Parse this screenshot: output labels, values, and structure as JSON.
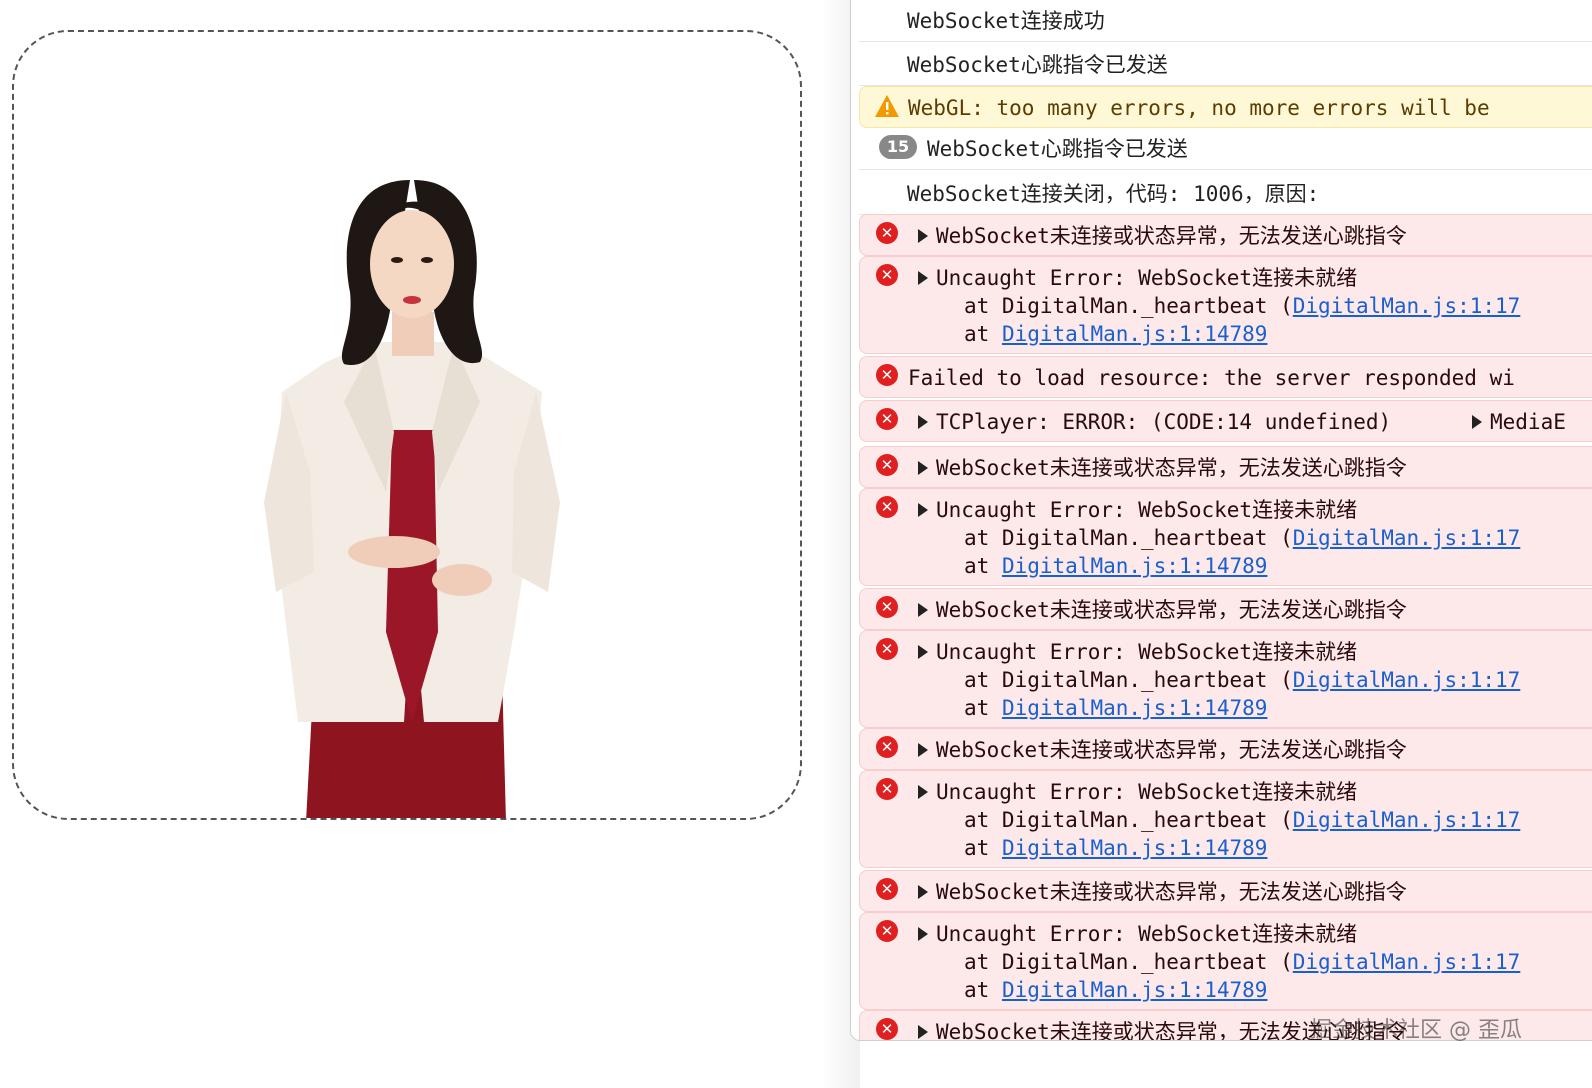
{
  "console": {
    "rows": [
      {
        "type": "info",
        "lines": [
          {
            "text": "WebSocket连接成功"
          }
        ]
      },
      {
        "type": "info",
        "lines": [
          {
            "text": "WebSocket心跳指令已发送"
          }
        ]
      },
      {
        "type": "warn",
        "lines": [
          {
            "text": "WebGL: too many errors, no more errors will be"
          }
        ]
      },
      {
        "type": "info",
        "count": "15",
        "lines": [
          {
            "text": "WebSocket心跳指令已发送"
          }
        ]
      },
      {
        "type": "info",
        "lines": [
          {
            "text": "WebSocket连接关闭，代码: 1006，原因:"
          }
        ]
      },
      {
        "type": "error",
        "expand": true,
        "lines": [
          {
            "text": "WebSocket未连接或状态异常，无法发送心跳指令"
          }
        ]
      },
      {
        "type": "error",
        "expand": true,
        "lines": [
          {
            "text": "Uncaught Error: WebSocket连接未就绪"
          },
          {
            "text": "at DigitalMan._heartbeat (",
            "link": "DigitalMan.js:1:17"
          },
          {
            "text": "at ",
            "link": "DigitalMan.js:1:14789"
          }
        ]
      },
      {
        "type": "error",
        "expand": false,
        "lines": [
          {
            "text": "Failed to load resource: the server responded wi"
          }
        ]
      },
      {
        "type": "error",
        "expand": true,
        "lines": [
          {
            "text": "TCPlayer: ERROR: (CODE:14 undefined)",
            "extra": "MediaE"
          }
        ]
      },
      {
        "type": "error",
        "expand": true,
        "lines": [
          {
            "text": "WebSocket未连接或状态异常，无法发送心跳指令"
          }
        ]
      },
      {
        "type": "error",
        "expand": true,
        "lines": [
          {
            "text": "Uncaught Error: WebSocket连接未就绪"
          },
          {
            "text": "at DigitalMan._heartbeat (",
            "link": "DigitalMan.js:1:17"
          },
          {
            "text": "at ",
            "link": "DigitalMan.js:1:14789"
          }
        ]
      },
      {
        "type": "error",
        "expand": true,
        "lines": [
          {
            "text": "WebSocket未连接或状态异常，无法发送心跳指令"
          }
        ]
      },
      {
        "type": "error",
        "expand": true,
        "lines": [
          {
            "text": "Uncaught Error: WebSocket连接未就绪"
          },
          {
            "text": "at DigitalMan._heartbeat (",
            "link": "DigitalMan.js:1:17"
          },
          {
            "text": "at ",
            "link": "DigitalMan.js:1:14789"
          }
        ]
      },
      {
        "type": "error",
        "expand": true,
        "lines": [
          {
            "text": "WebSocket未连接或状态异常，无法发送心跳指令"
          }
        ]
      },
      {
        "type": "error",
        "expand": true,
        "lines": [
          {
            "text": "Uncaught Error: WebSocket连接未就绪"
          },
          {
            "text": "at DigitalMan._heartbeat (",
            "link": "DigitalMan.js:1:17"
          },
          {
            "text": "at ",
            "link": "DigitalMan.js:1:14789"
          }
        ]
      },
      {
        "type": "error",
        "expand": true,
        "lines": [
          {
            "text": "WebSocket未连接或状态异常，无法发送心跳指令"
          }
        ]
      },
      {
        "type": "error",
        "expand": true,
        "lines": [
          {
            "text": "Uncaught Error: WebSocket连接未就绪"
          },
          {
            "text": "at DigitalMan._heartbeat (",
            "link": "DigitalMan.js:1:17"
          },
          {
            "text": "at ",
            "link": "DigitalMan.js:1:14789"
          }
        ]
      },
      {
        "type": "error",
        "expand": true,
        "lines": [
          {
            "text": "WebSocket未连接或状态异常，无法发送心跳指令"
          }
        ]
      }
    ]
  },
  "watermark": "掘金技术社区 @ 歪瓜",
  "colors": {
    "error_bg": "#fde9e9",
    "warn_bg": "#fff8d6",
    "link": "#1a5fd0",
    "jacket": "#f3ece4",
    "dress": "#8e1420",
    "hair": "#1e1714"
  }
}
